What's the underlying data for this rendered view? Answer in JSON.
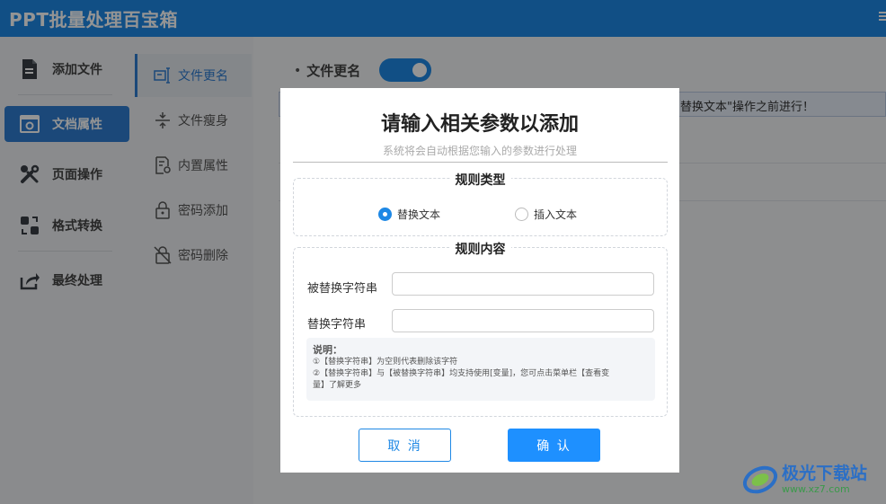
{
  "app": {
    "title": "PPT批量处理百宝箱"
  },
  "sidebar": {
    "items": [
      {
        "label": "添加文件",
        "icon": "file-icon"
      },
      {
        "label": "文档属性",
        "icon": "document-settings-icon"
      },
      {
        "label": "页面操作",
        "icon": "tools-icon"
      },
      {
        "label": "格式转换",
        "icon": "convert-icon"
      },
      {
        "label": "最终处理",
        "icon": "share-icon"
      }
    ],
    "active": "文档属性"
  },
  "subnav": {
    "items": [
      {
        "label": "文件更名",
        "icon": "rename-icon"
      },
      {
        "label": "文件瘦身",
        "icon": "compress-icon"
      },
      {
        "label": "内置属性",
        "icon": "properties-icon"
      },
      {
        "label": "密码添加",
        "icon": "lock-icon"
      },
      {
        "label": "密码删除",
        "icon": "unlock-icon"
      }
    ],
    "active": "文件更名"
  },
  "main": {
    "option_label": "文件更名",
    "toggle_on": true,
    "notice": "替换文本\"操作之前进行！"
  },
  "modal": {
    "title": "请输入相关参数以添加",
    "subtitle": "系统将会自动根据您输入的参数进行处理",
    "rule_type": {
      "legend": "规则类型",
      "options": [
        "替换文本",
        "插入文本"
      ],
      "selected": "替换文本"
    },
    "rule_content": {
      "legend": "规则内容",
      "find_label": "被替换字符串",
      "find_value": "",
      "replace_label": "替换字符串",
      "replace_value": ""
    },
    "note": {
      "title": "说明：",
      "line1": "①【替换字符串】为空则代表删除该字符",
      "line2": "②【替换字符串】与【被替换字符串】均支持使用[变量]，您可点击菜单栏【查看变",
      "line3": "量】了解更多"
    },
    "cancel_label": "取 消",
    "confirm_label": "确 认"
  },
  "watermark": {
    "text": "极光下载站",
    "url": "www.xz7.com"
  },
  "colors": {
    "accent": "#1e88e5",
    "sidebar_active": "#2f7dd1"
  }
}
